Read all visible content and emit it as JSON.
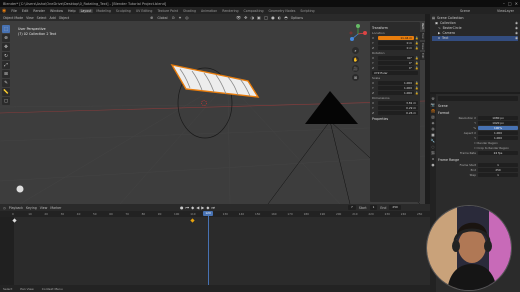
{
  "titlebar": {
    "text": "Blender* [C:\\Users\\Asha\\OneDrive\\Desktop\\0_Rotating_Text] - [Blender Tutorial Project.blend]"
  },
  "menubar": {
    "items": [
      "File",
      "Edit",
      "Render",
      "Window",
      "Help"
    ],
    "workspaces": [
      "Layout",
      "Modeling",
      "Sculpting",
      "UV Editing",
      "Texture Paint",
      "Shading",
      "Animation",
      "Rendering",
      "Compositing",
      "Geometry Nodes",
      "Scripting"
    ],
    "active_workspace": "Layout",
    "scene": "Scene",
    "view_layer": "ViewLayer"
  },
  "viewport_header": {
    "items": [
      "Object Mode",
      "View",
      "Select",
      "Add",
      "Object"
    ],
    "transform": "Global",
    "options": "Options"
  },
  "viewport": {
    "info_line1": "User Perspective",
    "info_line2": "(7) 02 Collection 2 Text",
    "accent_color": "#e87d0d",
    "background_color": "#3d3d3d"
  },
  "n_panel": {
    "section": "Transform",
    "location_label": "Location",
    "location": [
      {
        "axis": "X",
        "value": "11.44 m",
        "highlight": true
      },
      {
        "axis": "Y",
        "value": "0 m",
        "highlight": false
      },
      {
        "axis": "Z",
        "value": "0 m",
        "highlight": false
      }
    ],
    "rotation_label": "Rotation",
    "rotation": [
      {
        "axis": "X",
        "value": "90°"
      },
      {
        "axis": "Y",
        "value": "0°"
      },
      {
        "axis": "Z",
        "value": "0°"
      }
    ],
    "mode": "XYZ Euler",
    "scale_label": "Scale",
    "scale": [
      {
        "axis": "X",
        "value": "1.000"
      },
      {
        "axis": "Y",
        "value": "1.000"
      },
      {
        "axis": "Z",
        "value": "1.000"
      }
    ],
    "dimensions_label": "Dimensions",
    "dimensions": [
      {
        "axis": "X",
        "value": "3.81 m"
      },
      {
        "axis": "Y",
        "value": "0.29 m"
      },
      {
        "axis": "Z",
        "value": "0.26 m"
      }
    ],
    "properties_label": "Properties",
    "tabs": [
      "Item",
      "Tool",
      "View",
      "Edit"
    ]
  },
  "outliner": {
    "rows": [
      {
        "label": "Scene Collection",
        "indent": 0,
        "selected": false
      },
      {
        "label": "Collection",
        "indent": 1,
        "selected": false
      },
      {
        "label": "BezierCircle",
        "indent": 2,
        "selected": false
      },
      {
        "label": "Camera",
        "indent": 2,
        "selected": false
      },
      {
        "label": "Text",
        "indent": 2,
        "selected": true
      }
    ]
  },
  "properties": {
    "search_placeholder": "",
    "scene_label": "Scene",
    "format_label": "Format",
    "rows": [
      {
        "label": "Resolution X",
        "value": "1080 px",
        "blue": false
      },
      {
        "label": "Y",
        "value": "1920 px",
        "blue": false
      },
      {
        "label": "%",
        "value": "100%",
        "blue": true
      },
      {
        "label": "Aspect X",
        "value": "1.000",
        "blue": false
      },
      {
        "label": "Y",
        "value": "1.000",
        "blue": false
      }
    ],
    "render_region": "Render Region",
    "crop": "Crop to Render Region",
    "frame_rate_label": "Frame Rate",
    "frame_rate": "24 fps",
    "frame_range_label": "Frame Range",
    "frame_rows": [
      {
        "label": "Frame Start",
        "value": "1"
      },
      {
        "label": "End",
        "value": "250"
      },
      {
        "label": "Step",
        "value": "1"
      }
    ]
  },
  "timeline_header": {
    "items": [
      "Playback",
      "Keying",
      "View",
      "Marker"
    ],
    "current": "7",
    "start_label": "Start",
    "start": "1",
    "end_label": "End",
    "end": "250"
  },
  "timeline": {
    "ticks": [
      "0",
      "10",
      "20",
      "30",
      "40",
      "50",
      "60",
      "70",
      "80",
      "90",
      "100",
      "110",
      "120",
      "130",
      "140",
      "150",
      "160",
      "170",
      "180",
      "190",
      "200",
      "210",
      "220",
      "230",
      "240",
      "250"
    ],
    "current_frame": "120",
    "keyframes": [
      0,
      110
    ]
  },
  "statusbar": {
    "items": [
      "Select",
      "Pan View",
      "Context Menu"
    ]
  }
}
